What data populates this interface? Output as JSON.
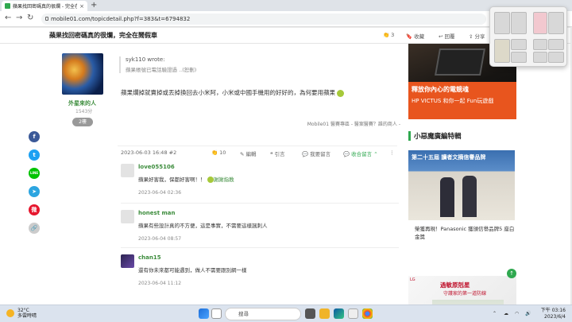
{
  "browser": {
    "tab_title": "蘋果找回密碼真的很爛 - 完全在",
    "tab_close": "×",
    "new_tab": "+",
    "url": "mobile01.com/topicdetail.php?f=383&t=6794832",
    "back": "←",
    "forward": "→",
    "reload": "↻"
  },
  "header": {
    "title": "蘋果找回密碼真的很爛，完全在鬧假車",
    "like_count": "3",
    "bookmark": "收藏",
    "reply": "回覆",
    "share": "分享"
  },
  "post": {
    "author": "外星來的人",
    "points": "1543分",
    "level": "2樓",
    "quote_author": "syk110 wrote:",
    "quote_text": "蘋果帳號已電話驗證過 ..(恕刪)",
    "body": "蘋果爛掉就賣掉或丟掉換回去小米阿，小米或中國手機用的好好的，為何要用蘋果",
    "note": "Mobile01 醫賽專區 - 醫案醫賽？誰的商人 -",
    "datetime": "2023-06-03 16:48 #2",
    "likes": "10",
    "actions": {
      "edit": "編輯",
      "quote": "引言",
      "report": "我要留言",
      "collapse": "收合留言",
      "more": "⋮"
    }
  },
  "social": [
    "f",
    "t",
    "LINE",
    "➤",
    "微",
    "🔗"
  ],
  "replies": [
    {
      "name": "love055106",
      "text": "蘋果好害我，保都好害啊！！",
      "extra": "謝謝指教",
      "time": "2023-06-04 02:36"
    },
    {
      "name": "honest man",
      "text": "蘋果有些設計真的不方便，這是事實，不需要這樣諷刺人",
      "time": "2023-06-04 08:57"
    },
    {
      "name": "chan15",
      "text": "還有你未來都可能遇到，做人不需要跟別網一樣",
      "time": "2023-06-04 11:12"
    }
  ],
  "sidebar": {
    "ad1_line1": "釋放你內心的電競魂",
    "ad1_line2": "HP VICTUS 和你一起 Fun玩遊戲",
    "section_title": "小惡魔廣編特輯",
    "ad2_banner": "第二十五屆 讀者文摘信譽品牌",
    "ad2_caption": "榮獲再現！Panasonic 獲頒信譽品牌5 座白金獎",
    "ad3_logo": "LG",
    "ad3_title": "過敏原剋星",
    "ad3_sub": "守護家的第一道防線"
  },
  "taskbar": {
    "weather_temp": "32°C",
    "weather_desc": "多雲時晴",
    "search_placeholder": "搜尋",
    "time": "下午 03:16",
    "date": "2023/6/4"
  },
  "colors": {
    "brand_green": "#2fa84f",
    "author_green": "#3c8c3c",
    "facebook": "#3b5998",
    "twitter": "#1da1f2",
    "line": "#00c300",
    "telegram": "#2ca5e0",
    "weibo": "#e6162d"
  }
}
